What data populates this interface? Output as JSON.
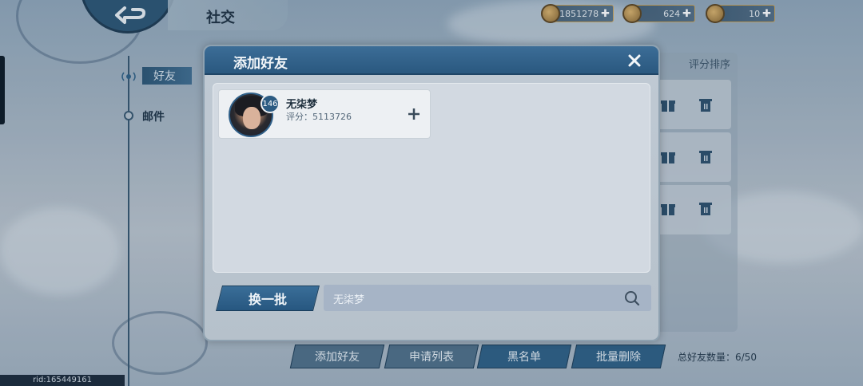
{
  "header": {
    "title": "社交",
    "back_icon": "back-arrow-icon"
  },
  "currencies": [
    {
      "icon": "coin-icon",
      "amount": "1851278"
    },
    {
      "icon": "ingot-icon",
      "amount": "624"
    },
    {
      "icon": "scroll-token-icon",
      "amount": "10"
    }
  ],
  "nav": {
    "friends_label": "好友",
    "mail_label": "邮件"
  },
  "friends_panel": {
    "sort_label": "评分排序"
  },
  "bottom_tabs": {
    "add_friend": "添加好友",
    "requests": "申请列表",
    "blacklist": "黑名单",
    "batch_delete": "批量删除",
    "friend_count": "总好友数量：6/50"
  },
  "footer": {
    "rid": "rid:165449161"
  },
  "modal": {
    "title": "添加好友",
    "close_icon": "close-icon",
    "players": [
      {
        "level": "146",
        "name": "无柒梦",
        "score": "评分：5113726"
      }
    ],
    "refresh_label": "换一批",
    "search": {
      "value": "无柒梦",
      "icon": "search-icon"
    }
  },
  "colors": {
    "primary_blue": "#2d5f85",
    "header_blue": "#3c6d97",
    "panel_bg": "#d2d9e1",
    "gold_border": "#c9a35b"
  }
}
